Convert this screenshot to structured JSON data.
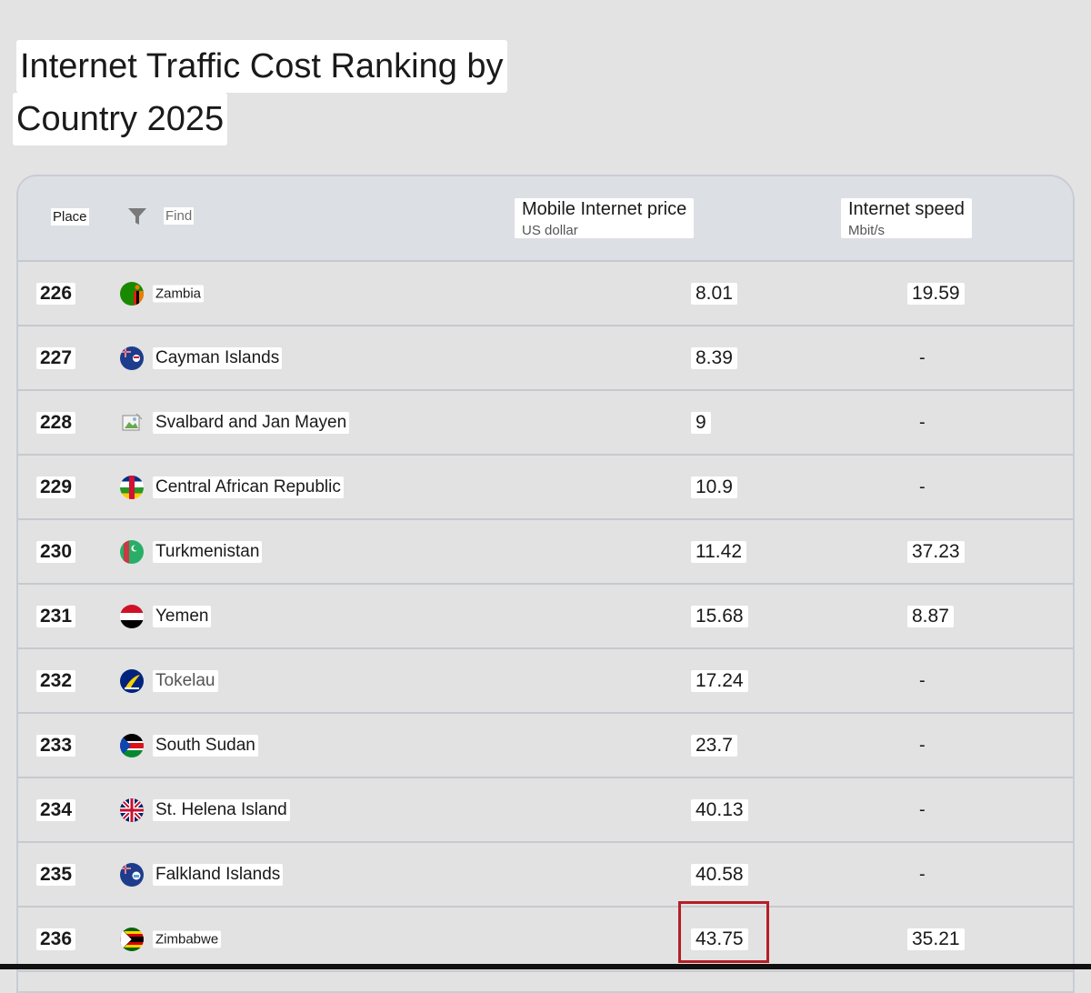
{
  "title": {
    "line1": "Internet Traffic Cost Ranking by",
    "line2": "Country 2025"
  },
  "table": {
    "headers": {
      "place": "Place",
      "find": "Find",
      "price": "Mobile Internet price",
      "price_unit": "US dollar",
      "speed": "Internet speed",
      "speed_unit": "Mbit/s"
    },
    "rows": [
      {
        "place": "226",
        "country": "Zambia",
        "price": "8.01",
        "speed": "19.59",
        "flag": "zambia-flag-icon"
      },
      {
        "place": "227",
        "country": "Cayman Islands",
        "price": "8.39",
        "speed": "-",
        "flag": "cayman-islands-flag-icon"
      },
      {
        "place": "228",
        "country": "Svalbard and Jan Mayen",
        "price": "9",
        "speed": "-",
        "flag": "broken-image-icon"
      },
      {
        "place": "229",
        "country": "Central African Republic",
        "price": "10.9",
        "speed": "-",
        "flag": "central-african-republic-flag-icon"
      },
      {
        "place": "230",
        "country": "Turkmenistan",
        "price": "11.42",
        "speed": "37.23",
        "flag": "turkmenistan-flag-icon"
      },
      {
        "place": "231",
        "country": "Yemen",
        "price": "15.68",
        "speed": "8.87",
        "flag": "yemen-flag-icon"
      },
      {
        "place": "232",
        "country": "Tokelau",
        "price": "17.24",
        "speed": "-",
        "flag": "tokelau-flag-icon"
      },
      {
        "place": "233",
        "country": "South Sudan",
        "price": "23.7",
        "speed": "-",
        "flag": "south-sudan-flag-icon"
      },
      {
        "place": "234",
        "country": "St. Helena Island",
        "price": "40.13",
        "speed": "-",
        "flag": "st-helena-flag-icon"
      },
      {
        "place": "235",
        "country": "Falkland Islands",
        "price": "40.58",
        "speed": "-",
        "flag": "falkland-islands-flag-icon"
      },
      {
        "place": "236",
        "country": "Zimbabwe",
        "price": "43.75",
        "speed": "35.21",
        "flag": "zimbabwe-flag-icon"
      }
    ]
  },
  "colors": {
    "background": "#e3e3e3",
    "header_bg": "#dcdfe4",
    "highlight_border": "#b51f24",
    "row_divider": "#c6c9cf"
  }
}
